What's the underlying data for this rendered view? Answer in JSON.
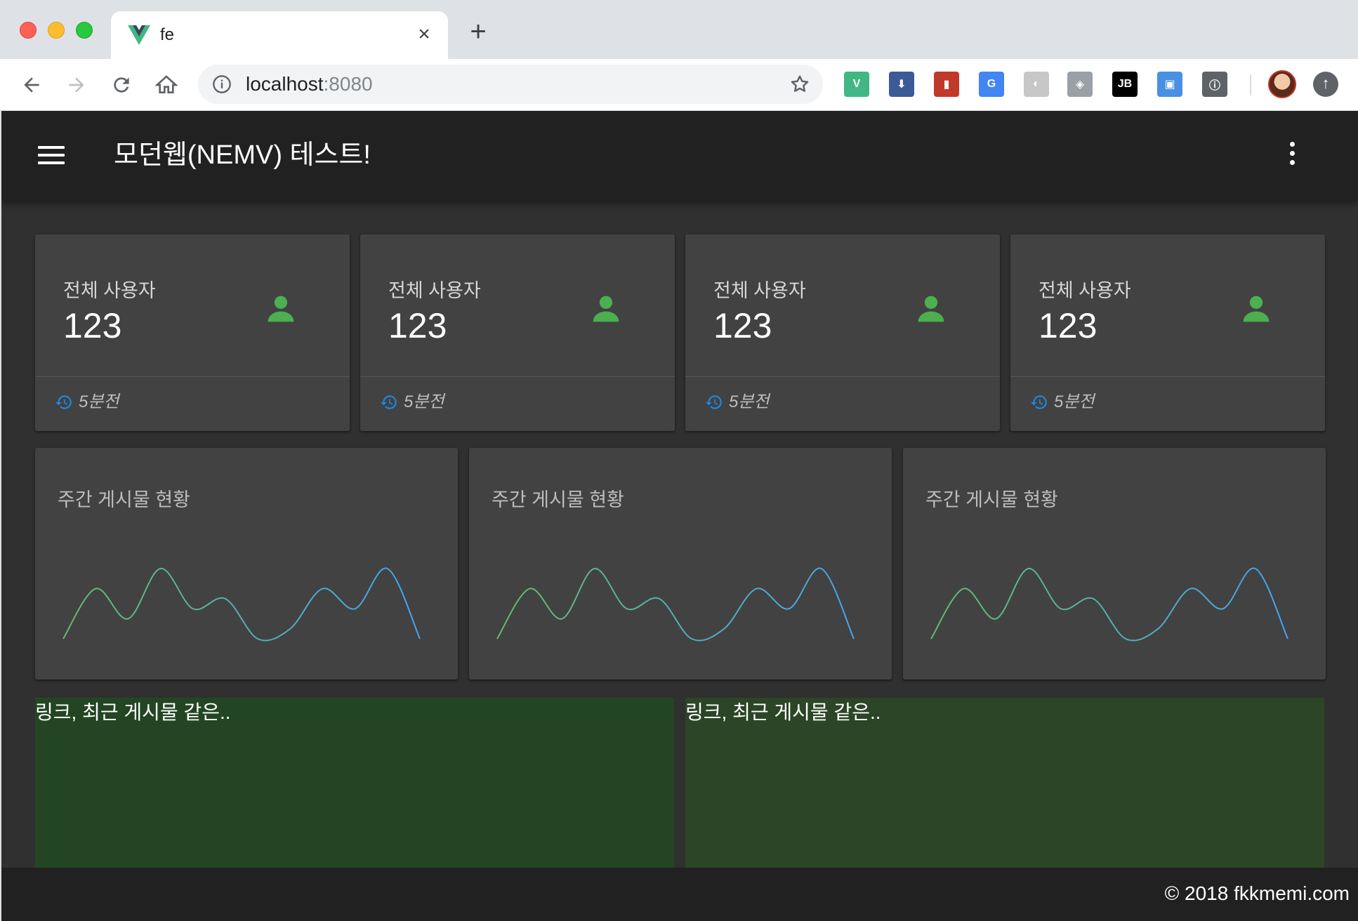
{
  "browser": {
    "tab": {
      "title": "fe",
      "favicon": "vue-logo-icon",
      "close_label": "×"
    },
    "new_tab_label": "+",
    "address": {
      "host": "localhost",
      "port": ":8080"
    },
    "extensions": [
      {
        "name": "vue-devtools-icon",
        "label": "V",
        "color": "#41b883"
      },
      {
        "name": "download-icon",
        "label": "⬇",
        "color": "#3d5a98"
      },
      {
        "name": "book-icon",
        "label": "▮",
        "color": "#c0392b"
      },
      {
        "name": "translate-icon",
        "label": "G",
        "color": "#4285f4"
      },
      {
        "name": "circle-icon",
        "label": "◐",
        "color": "#c7c7c7"
      },
      {
        "name": "shield-icon",
        "label": "◈",
        "color": "#9aa0a6"
      },
      {
        "name": "jetbrains-icon",
        "label": "JB",
        "color": "#000000"
      },
      {
        "name": "tag-icon",
        "label": "▣",
        "color": "#4a90e2"
      },
      {
        "name": "info-icon",
        "label": "ⓘ",
        "color": "#5f6368"
      }
    ]
  },
  "app": {
    "title": "모던웹(NEMV) 테스트!",
    "stats": [
      {
        "label": "전체 사용자",
        "value": "123",
        "footer": "5분전"
      },
      {
        "label": "전체 사용자",
        "value": "123",
        "footer": "5분전"
      },
      {
        "label": "전체 사용자",
        "value": "123",
        "footer": "5분전"
      },
      {
        "label": "전체 사용자",
        "value": "123",
        "footer": "5분전"
      }
    ],
    "charts": [
      {
        "title": "주간 게시물 현황"
      },
      {
        "title": "주간 게시물 현황"
      },
      {
        "title": "주간 게시물 현황"
      }
    ],
    "panels": [
      {
        "text": "링크, 최근 게시물 같은..",
        "color": "#234523"
      },
      {
        "text": "링크, 최근 게시물 같은..",
        "color": "#2b4526"
      }
    ],
    "footer": "© 2018 fkkmemi.com",
    "colors": {
      "accent_green": "#4caf50",
      "accent_blue": "#1e88e5",
      "sparkline_start": "#66bb6a",
      "sparkline_end": "#42a5f5"
    }
  },
  "chart_data": [
    {
      "type": "line",
      "title": "주간 게시물 현황",
      "x": [
        1,
        2,
        3,
        4,
        5,
        6,
        7,
        8,
        9,
        10,
        11,
        12
      ],
      "values": [
        0,
        5,
        2,
        7,
        3,
        4,
        0,
        1,
        5,
        3,
        7,
        0
      ],
      "grid": false,
      "legend": "none"
    },
    {
      "type": "line",
      "title": "주간 게시물 현황",
      "x": [
        1,
        2,
        3,
        4,
        5,
        6,
        7,
        8,
        9,
        10,
        11,
        12
      ],
      "values": [
        0,
        5,
        2,
        7,
        3,
        4,
        0,
        1,
        5,
        3,
        7,
        0
      ],
      "grid": false,
      "legend": "none"
    },
    {
      "type": "line",
      "title": "주간 게시물 현황",
      "x": [
        1,
        2,
        3,
        4,
        5,
        6,
        7,
        8,
        9,
        10,
        11,
        12
      ],
      "values": [
        0,
        5,
        2,
        7,
        3,
        4,
        0,
        1,
        5,
        3,
        7,
        0
      ],
      "grid": false,
      "legend": "none"
    }
  ]
}
